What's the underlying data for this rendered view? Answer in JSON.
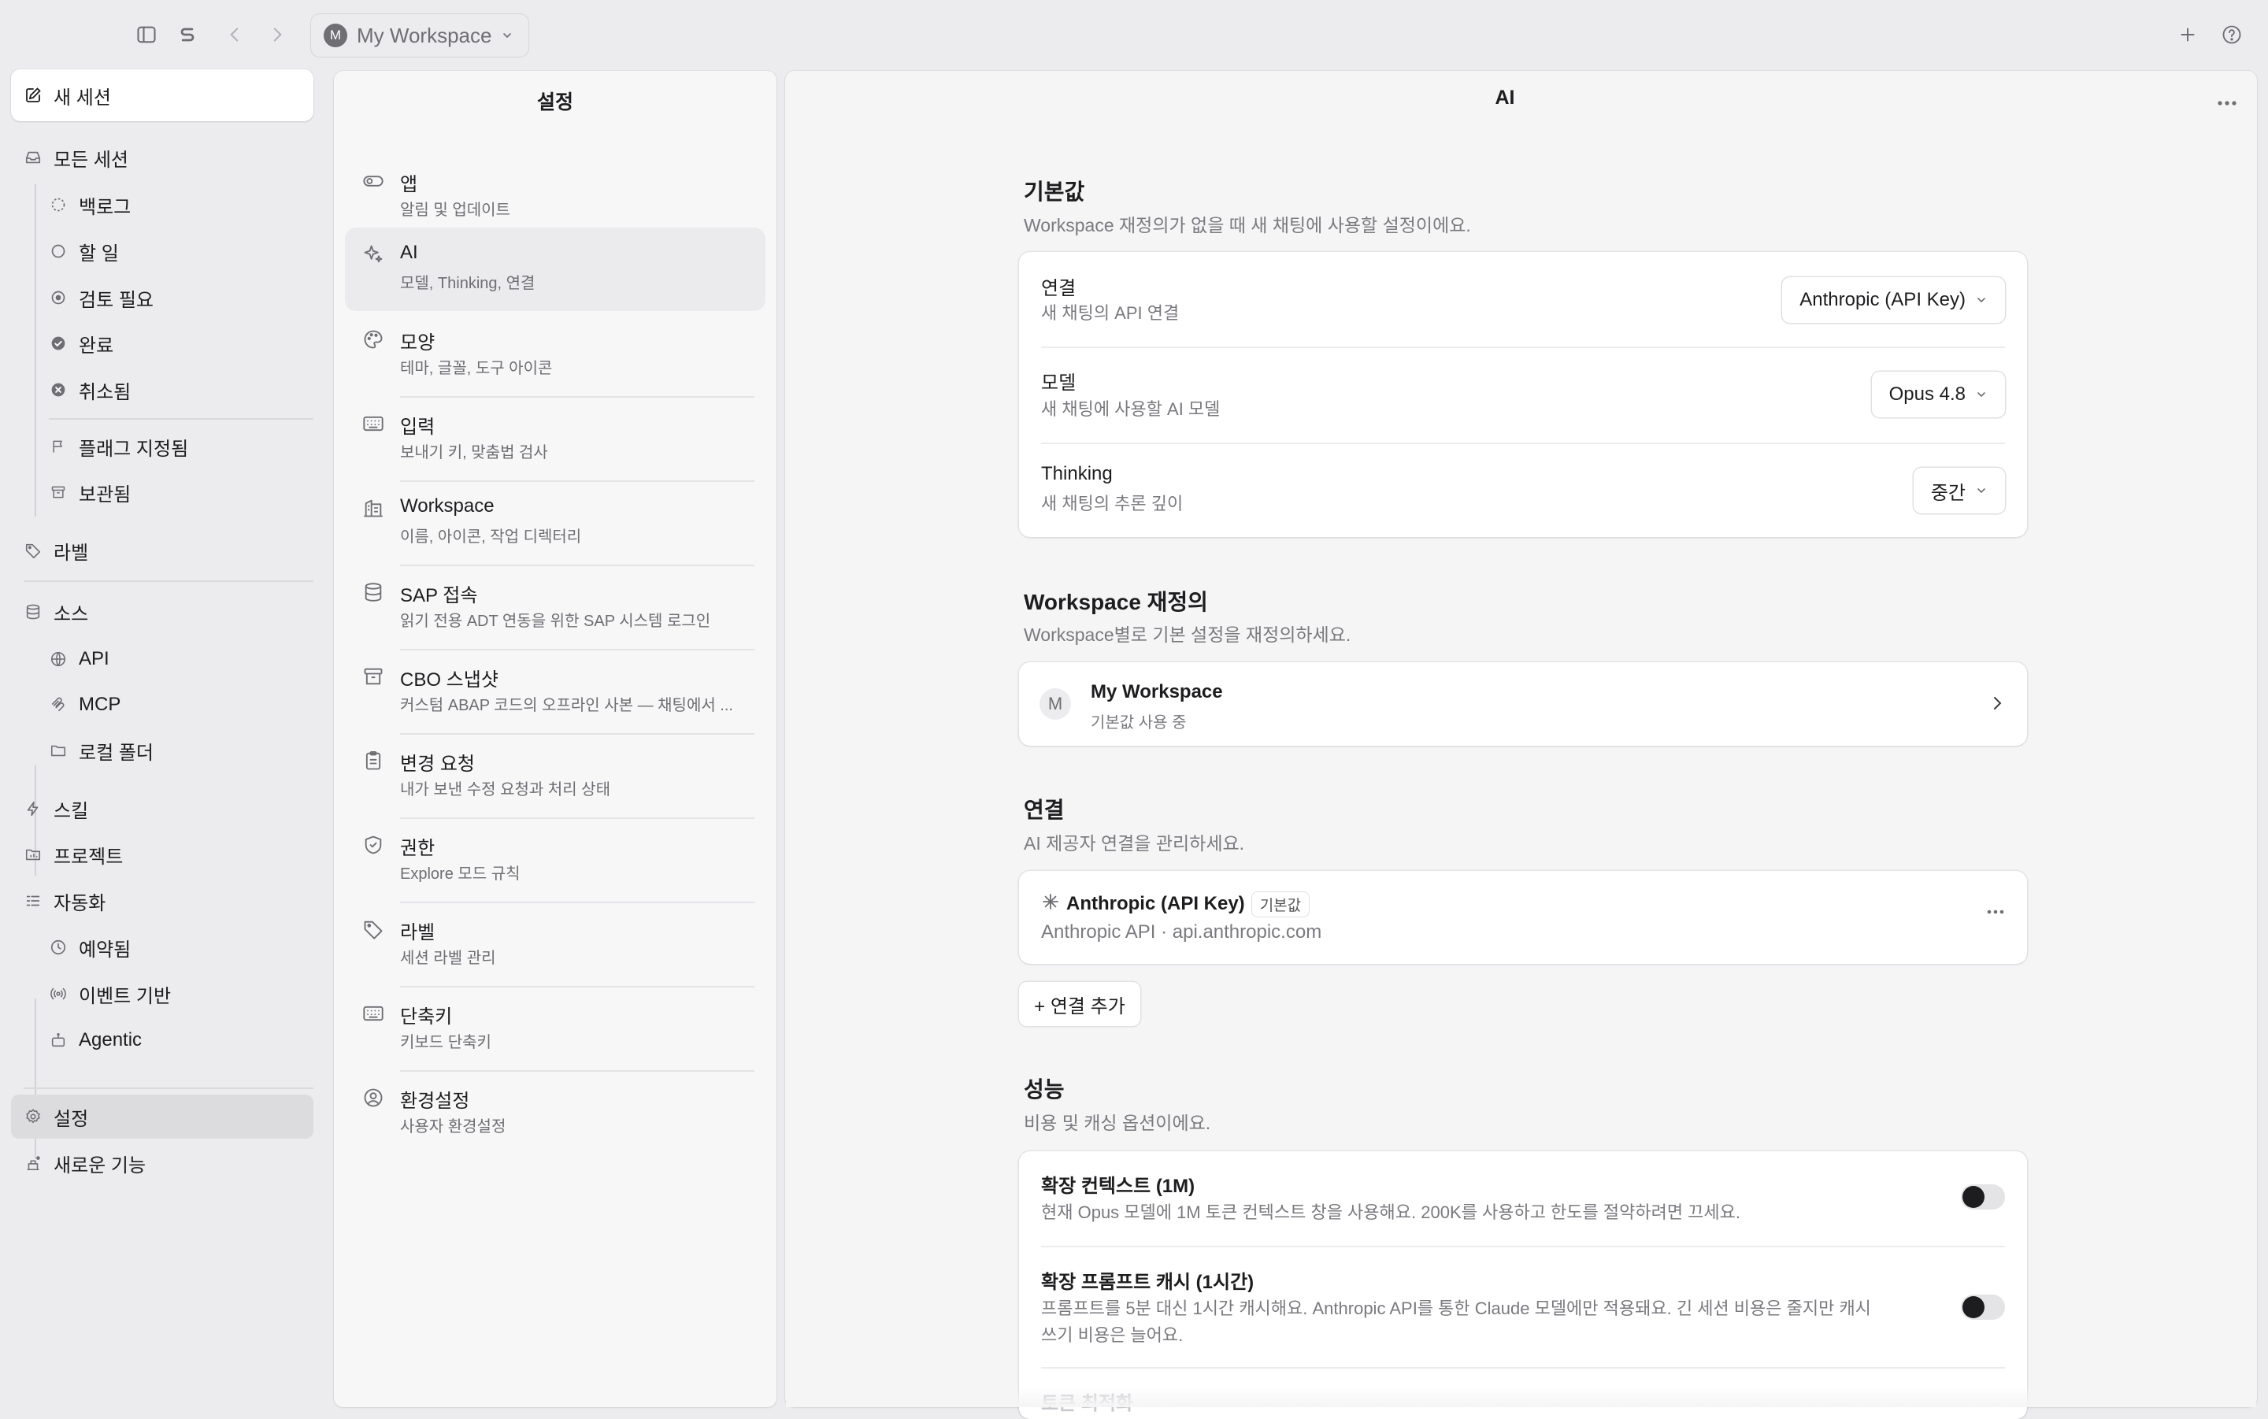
{
  "topbar": {
    "workspace_initial": "M",
    "workspace_name": "My Workspace"
  },
  "sidebar": {
    "new_session": "새 세션",
    "all_sessions": "모든 세션",
    "status_items": [
      "백로그",
      "할 일",
      "검토 필요",
      "완료",
      "취소됨"
    ],
    "flagged": "플래그 지정됨",
    "archived": "보관됨",
    "labels": "라벨",
    "sources": "소스",
    "source_items": [
      "API",
      "MCP",
      "로컬 폴더"
    ],
    "skills": "스킬",
    "projects": "프로젝트",
    "automation": "자동화",
    "automation_items": [
      "예약됨",
      "이벤트 기반",
      "Agentic"
    ],
    "settings": "설정",
    "whats_new": "새로운 기능"
  },
  "settings_panel": {
    "title": "설정",
    "items": [
      {
        "title": "앱",
        "sub": "알림 및 업데이트",
        "icon": "toggle-icon"
      },
      {
        "title": "AI",
        "sub": "모델, Thinking, 연결",
        "icon": "sparkle-icon"
      },
      {
        "title": "모양",
        "sub": "테마, 글꼴, 도구 아이콘",
        "icon": "palette-icon"
      },
      {
        "title": "입력",
        "sub": "보내기 키, 맞춤법 검사",
        "icon": "keyboard-icon"
      },
      {
        "title": "Workspace",
        "sub": "이름, 아이콘, 작업 디렉터리",
        "icon": "building-icon"
      },
      {
        "title": "SAP 접속",
        "sub": "읽기 전용 ADT 연동을 위한 SAP 시스템 로그인",
        "icon": "database-icon"
      },
      {
        "title": "CBO 스냅샷",
        "sub": "커스텀 ABAP 코드의 오프라인 사본 — 채팅에서 ...",
        "icon": "archive-icon"
      },
      {
        "title": "변경 요청",
        "sub": "내가 보낸 수정 요청과 처리 상태",
        "icon": "clipboard-icon"
      },
      {
        "title": "권한",
        "sub": "Explore 모드 규칙",
        "icon": "shield-icon"
      },
      {
        "title": "라벨",
        "sub": "세션 라벨 관리",
        "icon": "tag-icon"
      },
      {
        "title": "단축키",
        "sub": "키보드 단축키",
        "icon": "keyboard-icon"
      },
      {
        "title": "환경설정",
        "sub": "사용자 환경설정",
        "icon": "user-circle-icon"
      }
    ]
  },
  "main": {
    "title": "AI",
    "defaults": {
      "title": "기본값",
      "subtitle": "Workspace 재정의가 없을 때 새 채팅에 사용할 설정이에요.",
      "connection": {
        "label": "연결",
        "sub": "새 채팅의 API 연결",
        "value": "Anthropic (API Key)"
      },
      "model": {
        "label": "모델",
        "sub": "새 채팅에 사용할 AI 모델",
        "value": "Opus 4.8"
      },
      "thinking": {
        "label": "Thinking",
        "sub": "새 채팅의 추론 깊이",
        "value": "중간"
      }
    },
    "override": {
      "title": "Workspace 재정의",
      "subtitle": "Workspace별로 기본 설정을 재정의하세요.",
      "workspace_initial": "M",
      "workspace_name": "My Workspace",
      "workspace_status": "기본값 사용 중"
    },
    "connections": {
      "title": "연결",
      "subtitle": "AI 제공자 연결을 관리하세요.",
      "name": "Anthropic (API Key)",
      "badge": "기본값",
      "detail": "Anthropic API · api.anthropic.com",
      "add_label": "+ 연결 추가"
    },
    "performance": {
      "title": "성능",
      "subtitle": "비용 및 캐싱 옵션이에요.",
      "extended_context": {
        "label": "확장 컨텍스트 (1M)",
        "sub": "현재 Opus 모델에 1M 토큰 컨텍스트 창을 사용해요. 200K를 사용하고 한도를 절약하려면 끄세요.",
        "enabled": false
      },
      "prompt_cache": {
        "label": "확장 프롬프트 캐시 (1시간)",
        "sub_line1": "프롬프트를 5분 대신 1시간 캐시해요. Anthropic API를 통한 Claude 모델에만 적용돼요. 긴 세션 비용은 줄지만 캐시",
        "sub_line2": "쓰기 비용은 늘어요.",
        "enabled": false
      },
      "next_label": "토큰 최적화"
    }
  }
}
